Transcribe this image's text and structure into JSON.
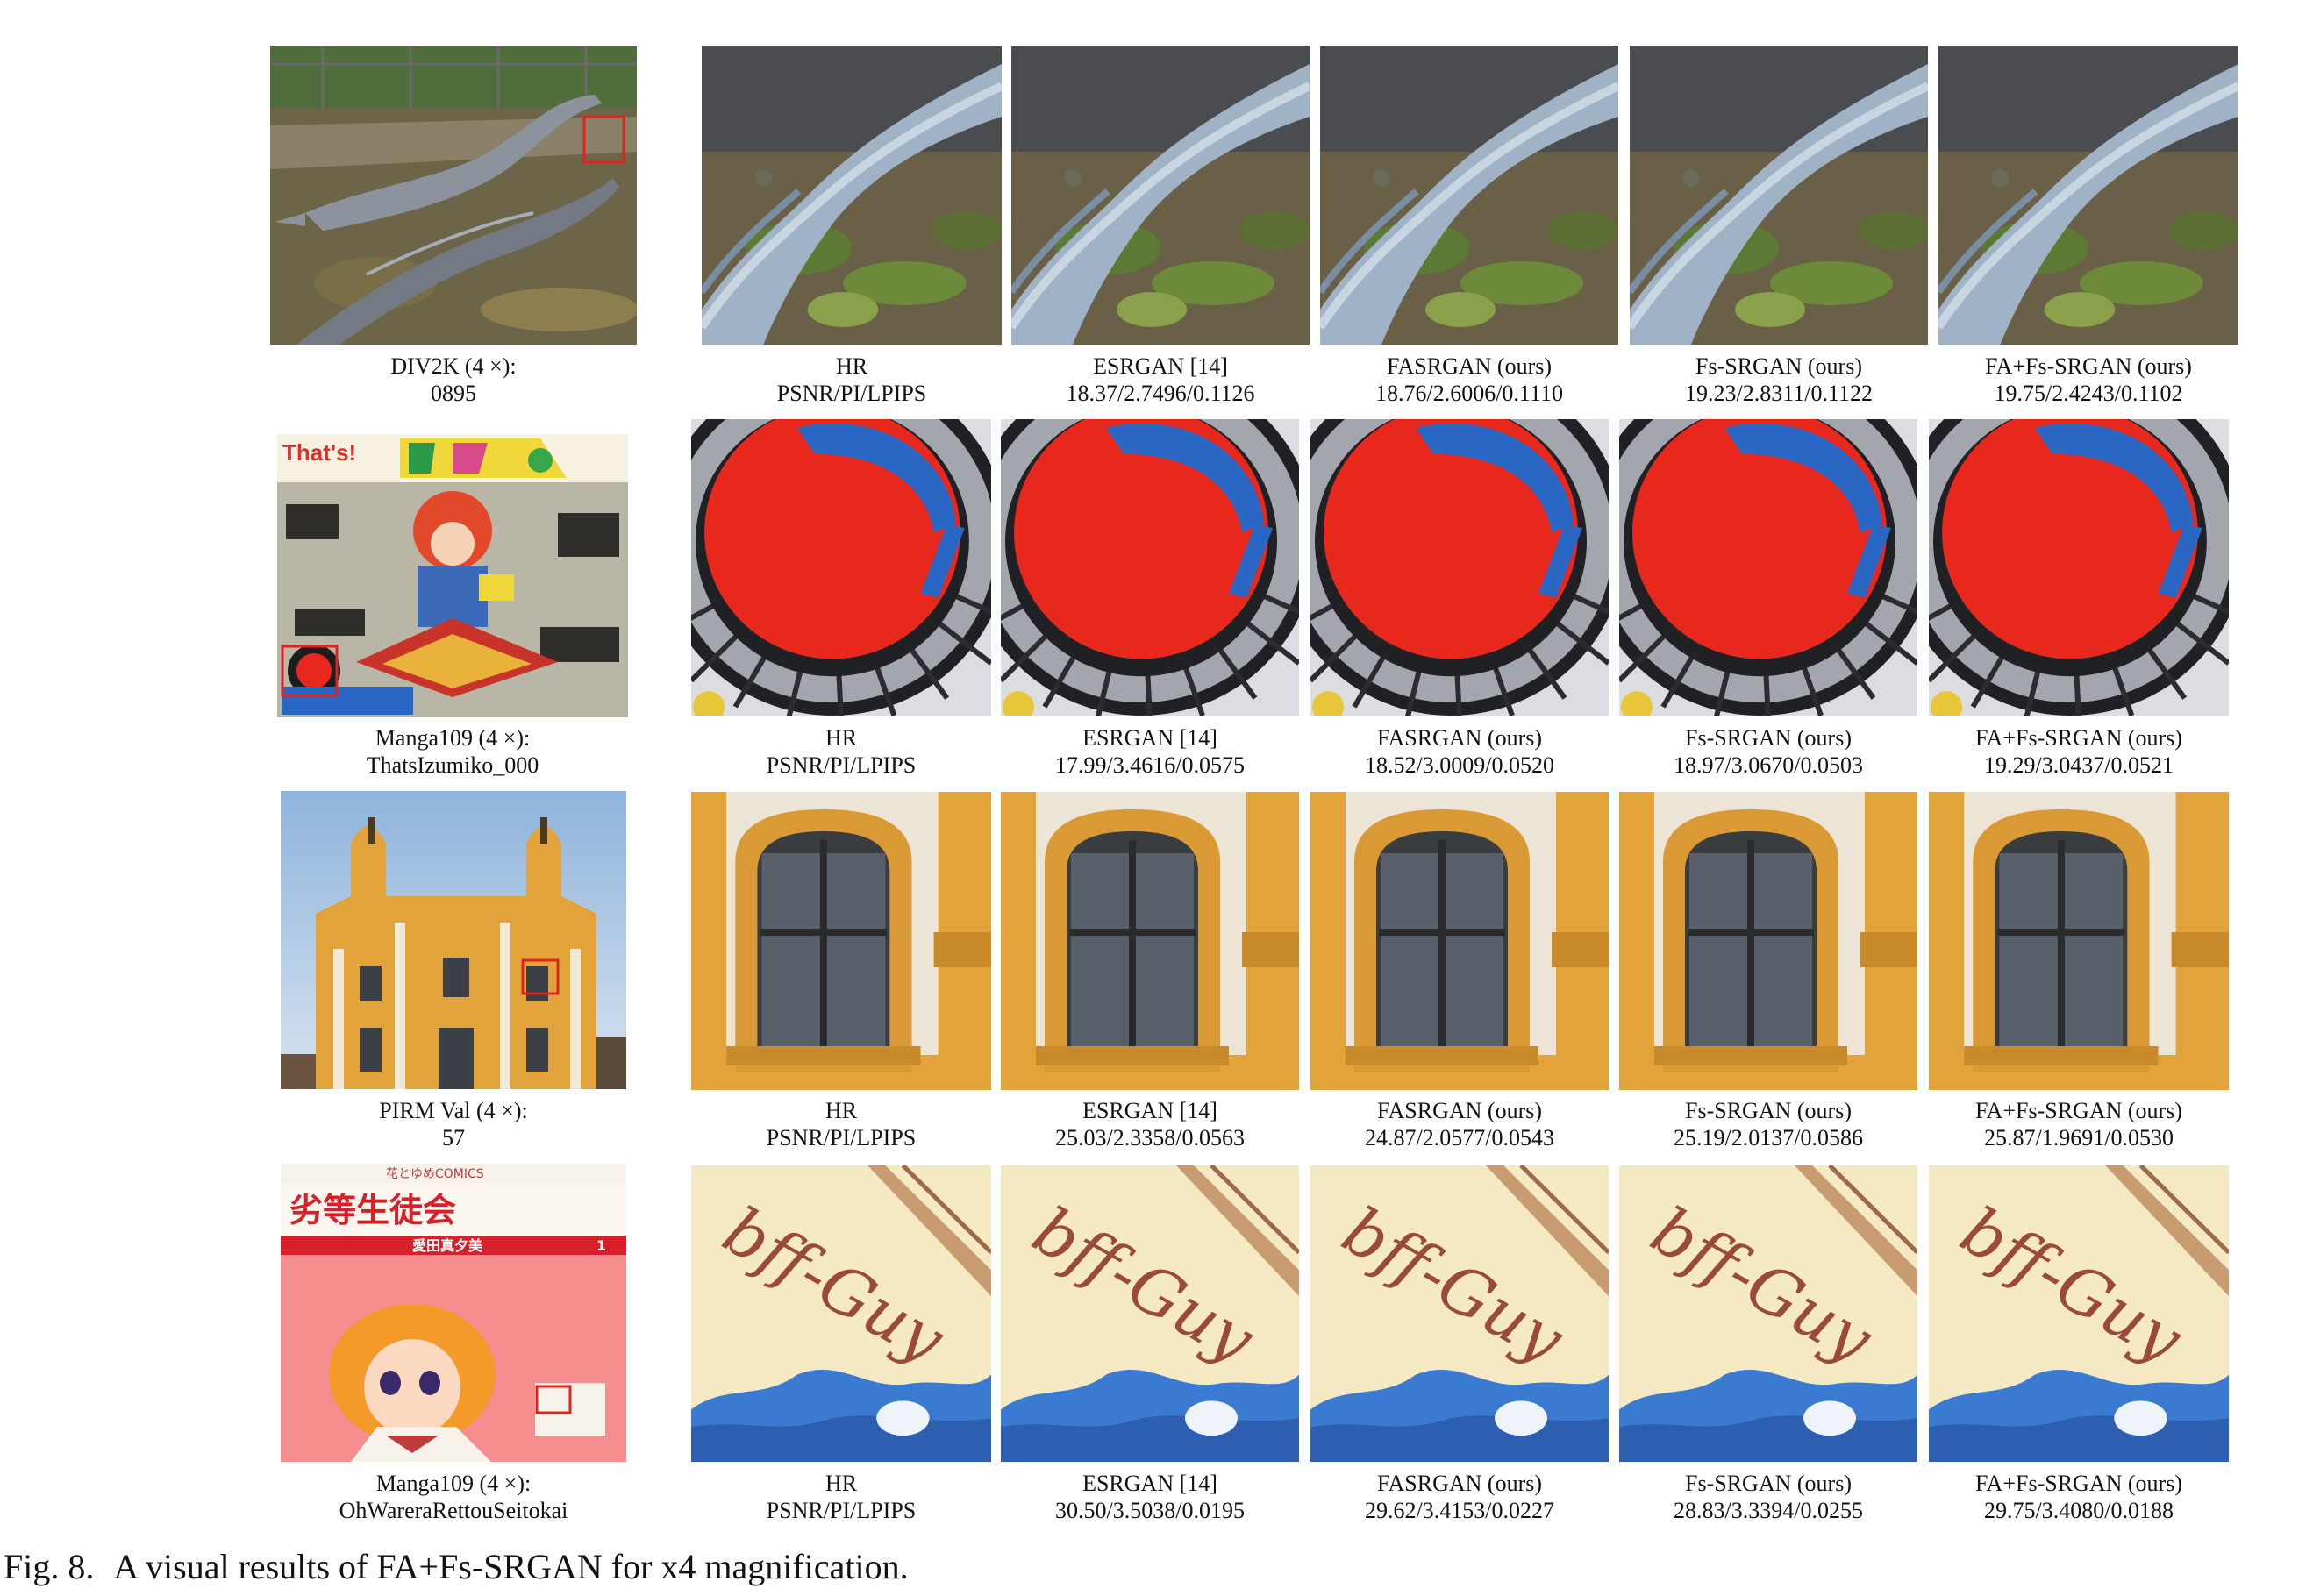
{
  "rows": [
    {
      "dataset": "DIV2K (4 ×):",
      "image_id": "0895",
      "columns": [
        {
          "method": "HR",
          "metrics": "PSNR/PI/LPIPS"
        },
        {
          "method": "ESRGAN  [14]",
          "metrics": "18.37/2.7496/0.1126"
        },
        {
          "method": "FASRGAN (ours)",
          "metrics": "18.76/2.6006/0.1110"
        },
        {
          "method": "Fs-SRGAN (ours)",
          "metrics": "19.23/2.8311/0.1122"
        },
        {
          "method": "FA+Fs-SRGAN (ours)",
          "metrics": "19.75/2.4243/0.1102"
        }
      ]
    },
    {
      "dataset": "Manga109 (4 ×):",
      "image_id": "ThatsIzumiko_000",
      "columns": [
        {
          "method": "HR",
          "metrics": "PSNR/PI/LPIPS"
        },
        {
          "method": "ESRGAN  [14]",
          "metrics": "17.99/3.4616/0.0575"
        },
        {
          "method": "FASRGAN (ours)",
          "metrics": "18.52/3.0009/0.0520"
        },
        {
          "method": "Fs-SRGAN (ours)",
          "metrics": "18.97/3.0670/0.0503"
        },
        {
          "method": "FA+Fs-SRGAN (ours)",
          "metrics": "19.29/3.0437/0.0521"
        }
      ]
    },
    {
      "dataset": "PIRM Val (4 ×):",
      "image_id": "57",
      "columns": [
        {
          "method": "HR",
          "metrics": "PSNR/PI/LPIPS"
        },
        {
          "method": "ESRGAN  [14]",
          "metrics": "25.03/2.3358/0.0563"
        },
        {
          "method": "FASRGAN (ours)",
          "metrics": "24.87/2.0577/0.0543"
        },
        {
          "method": "Fs-SRGAN (ours)",
          "metrics": "25.19/2.0137/0.0586"
        },
        {
          "method": "FA+Fs-SRGAN (ours)",
          "metrics": "25.87/1.9691/0.0530"
        }
      ]
    },
    {
      "dataset": "Manga109 (4 ×):",
      "image_id": "OhWareraRettouSeitokai",
      "columns": [
        {
          "method": "HR",
          "metrics": "PSNR/PI/LPIPS"
        },
        {
          "method": "ESRGAN  [14]",
          "metrics": "30.50/3.5038/0.0195"
        },
        {
          "method": "FASRGAN (ours)",
          "metrics": "29.62/3.4153/0.0227"
        },
        {
          "method": "Fs-SRGAN (ours)",
          "metrics": "28.83/3.3394/0.0255"
        },
        {
          "method": "FA+Fs-SRGAN (ours)",
          "metrics": "29.75/3.4080/0.0188"
        }
      ]
    }
  ],
  "figure_caption": {
    "label": "Fig. 8.",
    "text": "A visual results of FA+Fs-SRGAN for x4 magnification."
  },
  "thumbnail_text": {
    "manga1_title": "That's!",
    "manga2_publisher": "花とゆめCOMICS",
    "manga2_title": "劣等生徒会",
    "manga2_subtitle": "愛田真夕美",
    "manga2_volume": "1"
  },
  "crop_text": {
    "ink_text": "bff-Guy"
  },
  "colors": {
    "highlight_box": "#e0231f",
    "manga_red": "#e8281c",
    "manga_blue": "#2a67c4",
    "facade_yellow": "#e2a43a",
    "paper_cream": "#f4e9c2"
  }
}
